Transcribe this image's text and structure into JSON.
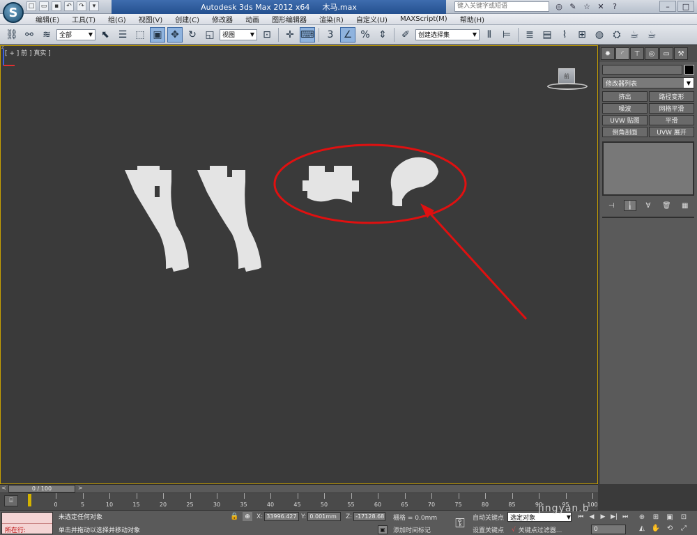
{
  "title_bar": {
    "app_name": "Autodesk 3ds Max  2012 x64",
    "file_name": "木马.max",
    "search_placeholder": "键入关键字或短语",
    "qa_icons": [
      "new-icon",
      "open-icon",
      "save-icon",
      "undo-icon",
      "redo-icon",
      "dropdown-icon"
    ],
    "tool_icons": [
      "binoculars-icon",
      "wrench-icon",
      "star-icon",
      "close-x-icon"
    ],
    "help_icon": "?"
  },
  "menu": {
    "items": [
      {
        "label": "编辑(E)"
      },
      {
        "label": "工具(T)"
      },
      {
        "label": "组(G)"
      },
      {
        "label": "视图(V)"
      },
      {
        "label": "创建(C)"
      },
      {
        "label": "修改器"
      },
      {
        "label": "动画"
      },
      {
        "label": "图形编辑器"
      },
      {
        "label": "渲染(R)"
      },
      {
        "label": "自定义(U)"
      },
      {
        "label": "MAXScript(M)"
      },
      {
        "label": "帮助(H)"
      }
    ]
  },
  "toolbar": {
    "selection_filter": "全部",
    "reference_coord": "视图",
    "named_selection": "创建选择集",
    "snap_label": "3"
  },
  "viewport": {
    "label": "[ + ] 前 ] 真实 ]",
    "viewcube_label": "前",
    "annotation_color": "#e01010"
  },
  "command_panel": {
    "modifier_list": "修改器列表",
    "modifier_buttons": [
      "挤出",
      "路径变形",
      "噪波",
      "网格平滑",
      "UVW 贴图",
      "平滑",
      "倒角剖面",
      "UVW 展开"
    ]
  },
  "time_slider": {
    "position": "0 / 100",
    "left_arrow": "<",
    "right_arrow": ">"
  },
  "track_bar": {
    "ticks": [
      "0",
      "5",
      "10",
      "15",
      "20",
      "25",
      "30",
      "35",
      "40",
      "45",
      "50",
      "55",
      "60",
      "65",
      "70",
      "75",
      "80",
      "85",
      "90",
      "95",
      "100"
    ]
  },
  "status": {
    "script_top": "",
    "script_bottom": "所在行:",
    "selection_msg": "未选定任何对象",
    "prompt_msg": "单击并拖动以选择并移动对象",
    "x_label": "X:",
    "x_value": "33996.427",
    "y_label": "Y:",
    "y_value": "0.001mm",
    "z_label": "Z:",
    "z_value": "-17128.68",
    "grid": "栅格 = 0.0mm",
    "add_time_tag": "添加时间标记",
    "auto_key": "自动关键点",
    "set_key": "设置关键点",
    "selected_object": "选定对象",
    "key_filters": "关键点过滤器...",
    "frame": "0"
  },
  "watermark": "jingyan.b"
}
